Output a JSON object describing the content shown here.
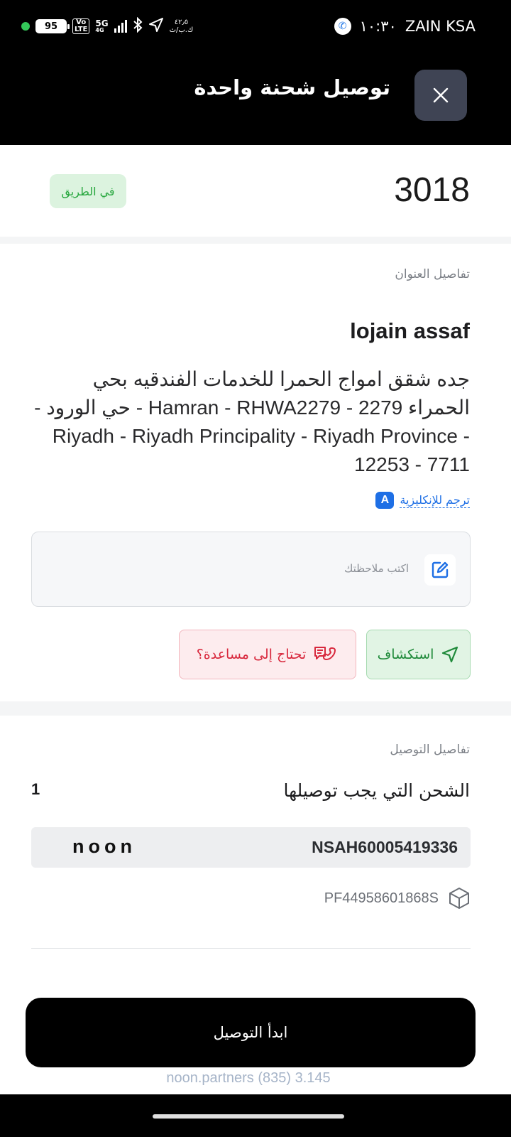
{
  "status_bar": {
    "battery": "95",
    "lte_badge": "Vo\nLTE",
    "network_type": "5G",
    "network_sub": "4G",
    "data_speed": "٤٢٫٥\nك.ب/ث",
    "time": "١٠:٣٠",
    "carrier": "ZAIN KSA",
    "icons": [
      "green-dot-icon",
      "battery-icon",
      "volte-icon",
      "signal-icon",
      "bluetooth-icon",
      "location-arrow-icon",
      "call-icon"
    ]
  },
  "header": {
    "title": "توصيل شحنة واحدة",
    "close_icon": "close-icon"
  },
  "order": {
    "number": "3018",
    "status": "في الطريق"
  },
  "address_section": {
    "label": "تفاصيل العنوان",
    "customer_name": "lojain assaf",
    "address": "جده شقق امواج الحمرا للخدمات الفندقيه بحي الحمراء 2279 - Hamran - RHWA2279 - حي الورود - Riyadh - Riyadh Principality - Riyadh Province - 12253 - 7711",
    "translate_label": "ترجم للإنكليزية",
    "translate_icon_letter": "A"
  },
  "note": {
    "placeholder": "اكتب ملاحظتك",
    "icon": "edit-note-icon"
  },
  "actions": {
    "explore_label": "استكشاف",
    "help_label": "تحتاج إلى مساعدة؟",
    "colors": {
      "explore": "#1f8a3a",
      "help": "#d8283d"
    }
  },
  "delivery_section": {
    "label": "تفاصيل التوصيل",
    "shipments_label": "الشحن التي يجب توصيلها",
    "shipments_count": "1",
    "shipment_id": "NSAH60005419336",
    "brand": "noon",
    "package_code": "PF44958601868S"
  },
  "cta": {
    "label": "ابدأ التوصيل"
  },
  "footer": {
    "text": "noon.partners (835) 3.145"
  }
}
